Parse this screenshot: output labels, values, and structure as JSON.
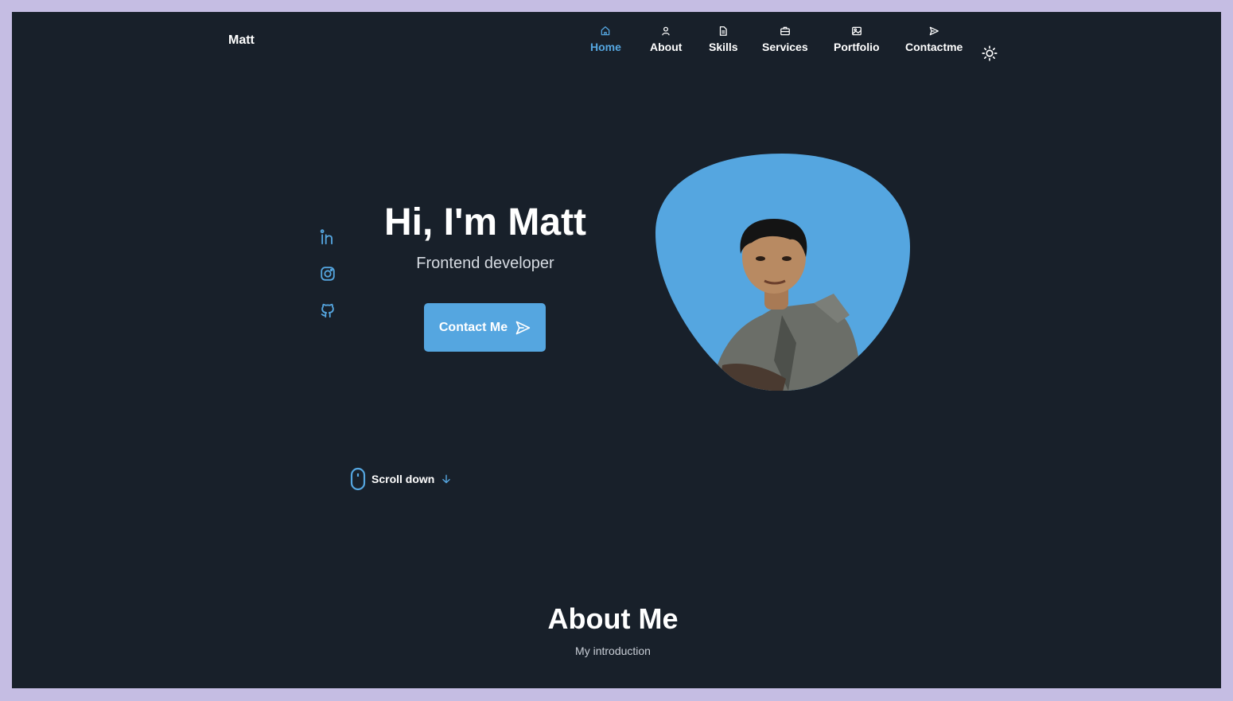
{
  "header": {
    "logo": "Matt",
    "nav": [
      {
        "label": "Home",
        "icon": "home-icon",
        "active": true
      },
      {
        "label": "About",
        "icon": "user-icon",
        "active": false
      },
      {
        "label": "Skills",
        "icon": "file-icon",
        "active": false
      },
      {
        "label": "Services",
        "icon": "briefcase-icon",
        "active": false
      },
      {
        "label": "Portfolio",
        "icon": "image-icon",
        "active": false
      },
      {
        "label": "Contactme",
        "icon": "send-icon",
        "active": false
      }
    ],
    "theme_icon": "sun-icon"
  },
  "hero": {
    "title": "Hi, I'm Matt",
    "subtitle": "Frontend developer",
    "button_label": "Contact Me",
    "button_icon": "send-icon",
    "socials": [
      "linkedin-icon",
      "instagram-icon",
      "github-icon"
    ],
    "photo": "profile-photo"
  },
  "scroll": {
    "label": "Scroll down",
    "icon": "mouse-icon",
    "arrow_icon": "arrow-down-icon"
  },
  "about": {
    "title": "About Me",
    "subtitle": "My introduction"
  },
  "colors": {
    "background": "#18202a",
    "accent": "#55a6e0",
    "text": "#ffffff",
    "muted": "#c9ced6",
    "page_border": "#c5bde3"
  }
}
